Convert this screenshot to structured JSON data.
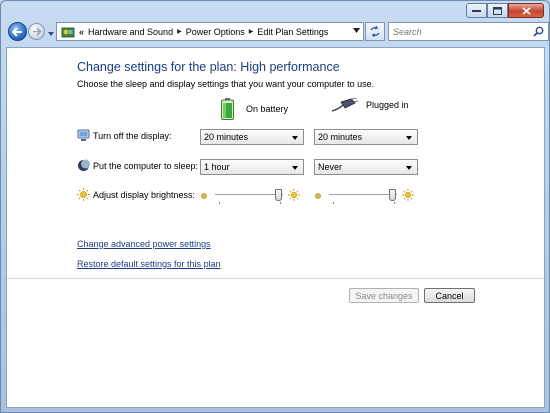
{
  "window": {
    "caption_buttons": [
      "minimize",
      "maximize",
      "close"
    ]
  },
  "navbar": {
    "breadcrumb": [
      {
        "label": "Hardware and Sound"
      },
      {
        "label": "Power Options"
      },
      {
        "label": "Edit Plan Settings"
      }
    ],
    "overflow_marker": "«",
    "separator": "▶",
    "search": {
      "placeholder": "Search",
      "value": ""
    }
  },
  "page": {
    "title": "Change settings for the plan: High performance",
    "subtitle": "Choose the sleep and display settings that you want your computer to use.",
    "columns": {
      "on_battery": "On battery",
      "plugged_in": "Plugged in"
    },
    "rows": {
      "display": {
        "label": "Turn off the display:",
        "on_battery": "20 minutes",
        "plugged_in": "20 minutes",
        "icon": "monitor-icon"
      },
      "sleep": {
        "label": "Put the computer to sleep:",
        "on_battery": "1 hour",
        "plugged_in": "Never",
        "icon": "moon-icon"
      },
      "brightness": {
        "label": "Adjust display brightness:",
        "on_battery_level": 0.93,
        "plugged_in_level": 0.93,
        "icon": "sun-icon"
      }
    },
    "links": {
      "advanced": "Change advanced power settings",
      "restore": "Restore default settings for this plan"
    },
    "buttons": {
      "save": "Save changes",
      "cancel": "Cancel"
    }
  },
  "colors": {
    "title": "#1c3d8a",
    "link": "#1c3d8a",
    "chrome": "#bcd3ea"
  }
}
